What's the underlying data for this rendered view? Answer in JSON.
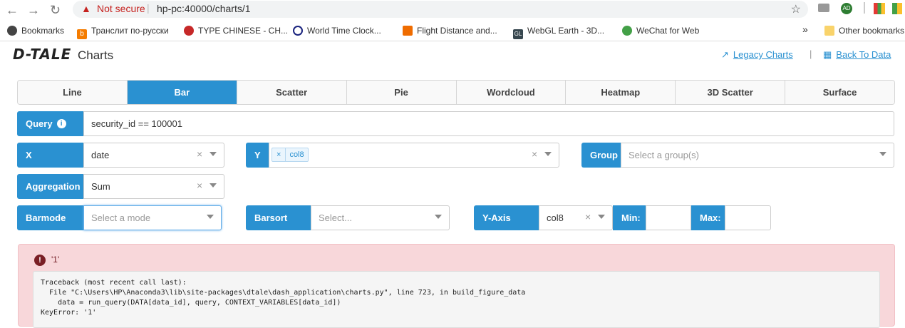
{
  "browser": {
    "security_label": "Not secure",
    "url": "hp-pc:40000/charts/1",
    "profile_initials": "AD"
  },
  "bookmarks": {
    "items": [
      {
        "label": "Bookmarks",
        "color": "#444"
      },
      {
        "label": "Транслит по-русски",
        "color": "#f57c00"
      },
      {
        "label": "TYPE CHINESE - CH...",
        "color": "#c62828"
      },
      {
        "label": "World Time Clock...",
        "color": "#1a237e"
      },
      {
        "label": "Flight Distance and...",
        "color": "#ef6c00"
      },
      {
        "label": "WebGL Earth - 3D...",
        "color": "#37474f"
      },
      {
        "label": "WeChat for Web",
        "color": "#43a047"
      }
    ],
    "overflow": "»",
    "other": "Other bookmarks"
  },
  "header": {
    "logo": "D-TALE",
    "title": "Charts",
    "legacy_link": "Legacy Charts",
    "sep": "|",
    "back_link": "Back To Data"
  },
  "tabs": [
    "Line",
    "Bar",
    "Scatter",
    "Pie",
    "Wordcloud",
    "Heatmap",
    "3D Scatter",
    "Surface"
  ],
  "active_tab": "Bar",
  "query": {
    "label": "Query",
    "value": "security_id == 100001"
  },
  "x": {
    "label": "X",
    "value": "date"
  },
  "y": {
    "label": "Y",
    "chip_x": "×",
    "chip": "col8"
  },
  "group": {
    "label": "Group",
    "placeholder": "Select a group(s)"
  },
  "aggregation": {
    "label": "Aggregation",
    "value": "Sum"
  },
  "barmode": {
    "label": "Barmode",
    "placeholder": "Select a mode"
  },
  "barsort": {
    "label": "Barsort",
    "placeholder": "Select..."
  },
  "yaxis": {
    "label": "Y-Axis",
    "value": "col8",
    "min_label": "Min:",
    "max_label": "Max:"
  },
  "error": {
    "message": "'1'",
    "traceback": "Traceback (most recent call last):\n  File \"C:\\Users\\HP\\Anaconda3\\lib\\site-packages\\dtale\\dash_application\\charts.py\", line 723, in build_figure_data\n    data = run_query(DATA[data_id], query, CONTEXT_VARIABLES[data_id])\nKeyError: '1'"
  }
}
